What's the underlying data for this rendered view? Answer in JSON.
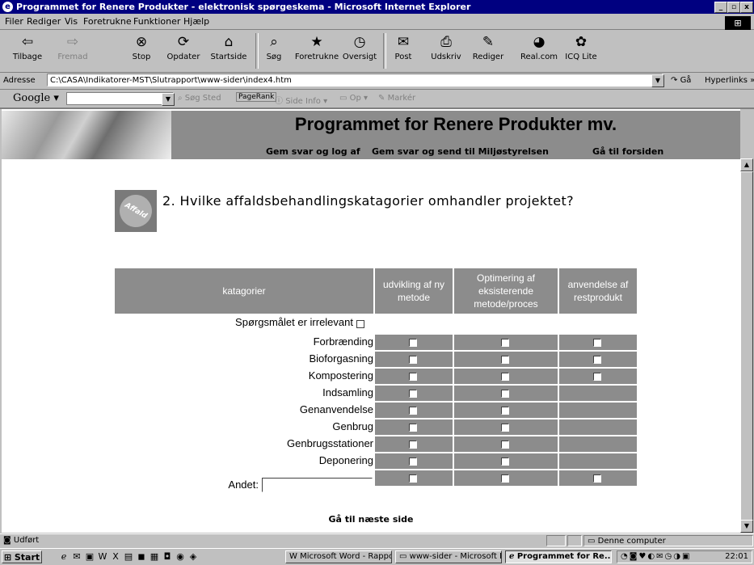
{
  "window": {
    "title": "Programmet for Renere Produkter - elektronisk spørgeskema - Microsoft Internet Explorer",
    "buttons": [
      "_",
      "▫",
      "x"
    ]
  },
  "menu": [
    "Filer",
    "Rediger",
    "Vis",
    "Foretrukne",
    "Funktioner",
    "Hjælp"
  ],
  "toolbar": [
    {
      "label": "Tilbage",
      "icon": "back-arrow-icon",
      "glyph": "⇦",
      "enabled": true
    },
    {
      "label": "Fremad",
      "icon": "forward-arrow-icon",
      "glyph": "⇨",
      "enabled": false
    },
    {
      "label": "Stop",
      "icon": "stop-icon",
      "glyph": "⊗",
      "enabled": true
    },
    {
      "label": "Opdater",
      "icon": "refresh-icon",
      "glyph": "⟳",
      "enabled": true
    },
    {
      "label": "Startside",
      "icon": "home-icon",
      "glyph": "⌂",
      "enabled": true
    },
    {
      "label": "Søg",
      "icon": "search-icon",
      "glyph": "⌕",
      "enabled": true
    },
    {
      "label": "Foretrukne",
      "icon": "favorites-icon",
      "glyph": "★",
      "enabled": true
    },
    {
      "label": "Oversigt",
      "icon": "history-icon",
      "glyph": "◷",
      "enabled": true
    },
    {
      "label": "Post",
      "icon": "mail-icon",
      "glyph": "✉",
      "enabled": true
    },
    {
      "label": "Udskriv",
      "icon": "print-icon",
      "glyph": "⎙",
      "enabled": true
    },
    {
      "label": "Rediger",
      "icon": "edit-icon",
      "glyph": "✎",
      "enabled": true
    },
    {
      "label": "Real.com",
      "icon": "realcom-icon",
      "glyph": "◕",
      "enabled": true
    },
    {
      "label": "ICQ Lite",
      "icon": "icq-icon",
      "glyph": "✿",
      "enabled": true
    }
  ],
  "address": {
    "label": "Adresse",
    "value": "C:\\CASA\\Indikatorer-MST\\Slutrapport\\www-sider\\index4.htm",
    "go": "Gå",
    "links": "Hyperlinks »"
  },
  "googlebar": {
    "logo": "Google",
    "items": [
      "Søg Sted",
      "PageRank",
      "Side Info",
      "Op",
      "Markér"
    ]
  },
  "site": {
    "title": "Programmet for Renere Produkter mv.",
    "nav": [
      "Gem svar og log af",
      "Gem svar og send til Miljøstyrelsen",
      "Gå til forsiden"
    ],
    "badge_text": "Affald",
    "question": "2. Hvilke affaldsbehandlingskatagorier omhandler projektet?",
    "table": {
      "headers": [
        "katagorier",
        "udvikling af ny metode",
        "Optimering af eksisterende metode/proces",
        "anvendelse af restprodukt"
      ],
      "irrelevant_label": "Spørgsmålet er irrelevant",
      "rows": [
        {
          "label": "Forbrænding",
          "boxes": [
            true,
            true,
            true
          ]
        },
        {
          "label": "Bioforgasning",
          "boxes": [
            true,
            true,
            true
          ]
        },
        {
          "label": "Kompostering",
          "boxes": [
            true,
            true,
            true
          ]
        },
        {
          "label": "Indsamling",
          "boxes": [
            true,
            true,
            false
          ]
        },
        {
          "label": "Genanvendelse",
          "boxes": [
            true,
            true,
            false
          ]
        },
        {
          "label": "Genbrug",
          "boxes": [
            true,
            true,
            false
          ]
        },
        {
          "label": "Genbrugsstationer",
          "boxes": [
            true,
            true,
            false
          ]
        },
        {
          "label": "Deponering",
          "boxes": [
            true,
            true,
            false
          ]
        }
      ],
      "other_label": "Andet:",
      "other_value": "",
      "other_boxes": [
        true,
        true,
        true
      ]
    },
    "next": "Gå til næste side"
  },
  "status": {
    "text": "Udført",
    "zone": "Denne computer"
  },
  "taskbar": {
    "start": "Start",
    "tasks": [
      {
        "label": "Microsoft Word - Rappo...",
        "active": false
      },
      {
        "label": "www-sider - Microsoft In...",
        "active": false
      },
      {
        "label": "Programmet for Re...",
        "active": true
      }
    ],
    "clock": "22:01"
  }
}
